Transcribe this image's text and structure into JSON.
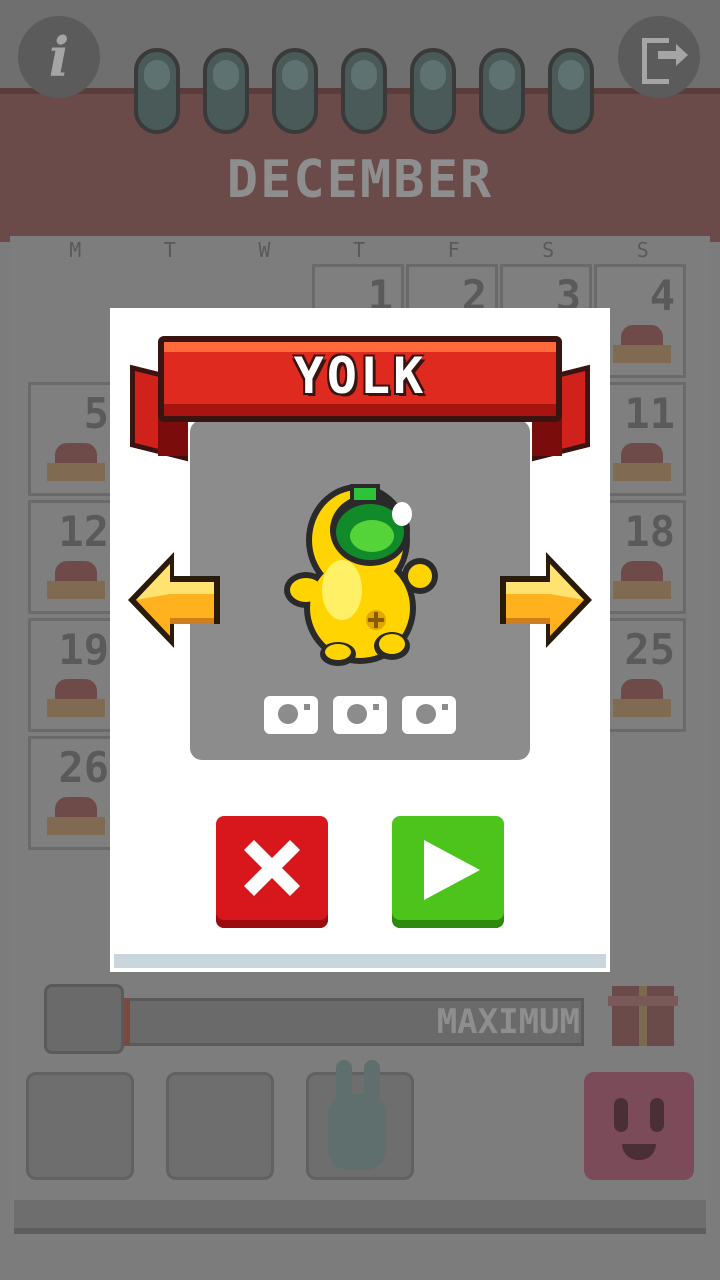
{
  "calendar": {
    "month": "DECEMBER",
    "weekdays": [
      "M",
      "T",
      "W",
      "T",
      "F",
      "S",
      "S"
    ],
    "days": [
      "1",
      "2",
      "3",
      "4",
      "5",
      "11",
      "12",
      "18",
      "19",
      "25",
      "26"
    ]
  },
  "top_bar": {
    "info_label": "i"
  },
  "progress": {
    "label": "MAXIMUM",
    "fill_fraction": 0.01
  },
  "dialog": {
    "title": "YOLK",
    "stars_total": 3,
    "stars_earned": 0
  },
  "colors": {
    "ribbon": "#df2a20",
    "close_button": "#d7171c",
    "play_button": "#4cc41b",
    "arrow": "#ffb21e",
    "character": "#ffe600"
  },
  "icons": {
    "left": "left-arrow-icon",
    "right": "right-arrow-icon",
    "close": "close-icon",
    "play": "play-icon",
    "info": "info-icon",
    "exit": "exit-icon"
  }
}
